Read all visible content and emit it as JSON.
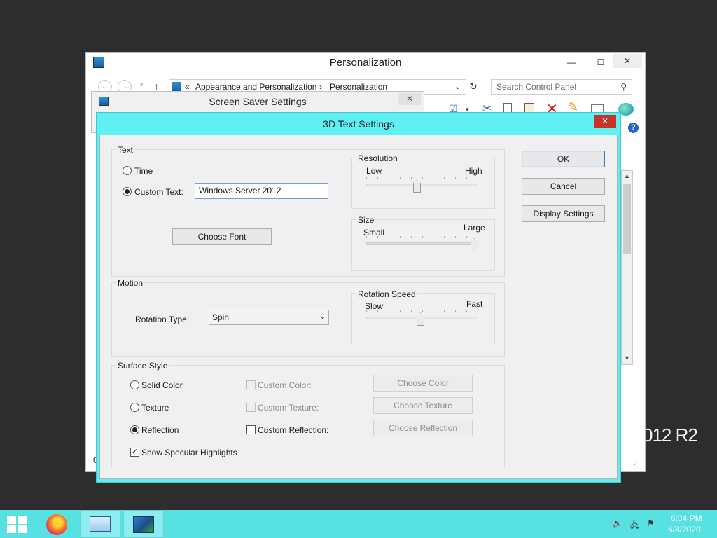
{
  "personalization": {
    "title": "Personalization",
    "back_icon": "left-arrow-icon",
    "address": {
      "chevrons": "«",
      "crumb1": "Appearance and Personalization",
      "sep": "›",
      "crumb2": "Personalization"
    },
    "search_placeholder": "Search Control Panel",
    "desktop_text": "012 R2",
    "status_left": "0"
  },
  "screensaver": {
    "title": "Screen Saver Settings",
    "close": "✕"
  },
  "dialog": {
    "title": "3D Text Settings",
    "close": "✕",
    "text_group": {
      "label": "Text",
      "time_label": "Time",
      "custom_text_label": "Custom Text:",
      "custom_text_value": "Windows Server 2012",
      "choose_font": "Choose Font"
    },
    "resolution": {
      "label": "Resolution",
      "low": "Low",
      "high": "High",
      "value_percent": 45
    },
    "size": {
      "label": "Size",
      "small": "Small",
      "large": "Large",
      "value_percent": 100
    },
    "motion": {
      "label": "Motion",
      "rotation_type_label": "Rotation Type:",
      "rotation_type_value": "Spin"
    },
    "rotation_speed": {
      "label": "Rotation Speed",
      "slow": "Slow",
      "fast": "Fast",
      "value_percent": 48
    },
    "surface": {
      "label": "Surface Style",
      "solid_color": "Solid Color",
      "texture": "Texture",
      "reflection": "Reflection",
      "custom_color": "Custom Color:",
      "custom_texture": "Custom Texture:",
      "custom_reflection": "Custom Reflection:",
      "choose_color": "Choose Color",
      "choose_texture": "Choose Texture",
      "choose_reflection": "Choose Reflection",
      "specular": "Show Specular Highlights"
    },
    "buttons": {
      "ok": "OK",
      "cancel": "Cancel",
      "display_settings": "Display Settings"
    }
  },
  "taskbar": {
    "time": "6:34 PM",
    "date": "6/8/2020"
  },
  "colors": {
    "dialog_frame": "#5ef0f3",
    "taskbar": "#57e1e3",
    "close_red": "#c7342a"
  }
}
